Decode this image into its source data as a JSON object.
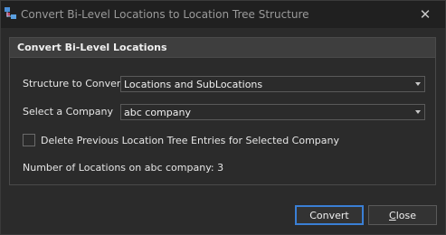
{
  "window": {
    "title": "Convert Bi-Level Locations to Location Tree Structure",
    "close_glyph": "✕"
  },
  "group": {
    "title": "Convert Bi-Level Locations"
  },
  "form": {
    "structure_label": "Structure to Convert",
    "structure_value": "Locations and SubLocations",
    "company_label": "Select a Company",
    "company_value": "abc company",
    "delete_label": "Delete Previous Location Tree Entries for Selected Company",
    "delete_checked": false,
    "count_text": "Number of Locations on abc company: 3"
  },
  "buttons": {
    "convert_label": "Convert",
    "close_label": "Close"
  },
  "colors": {
    "background": "#2b2b2b",
    "accent": "#3a7fd5"
  }
}
